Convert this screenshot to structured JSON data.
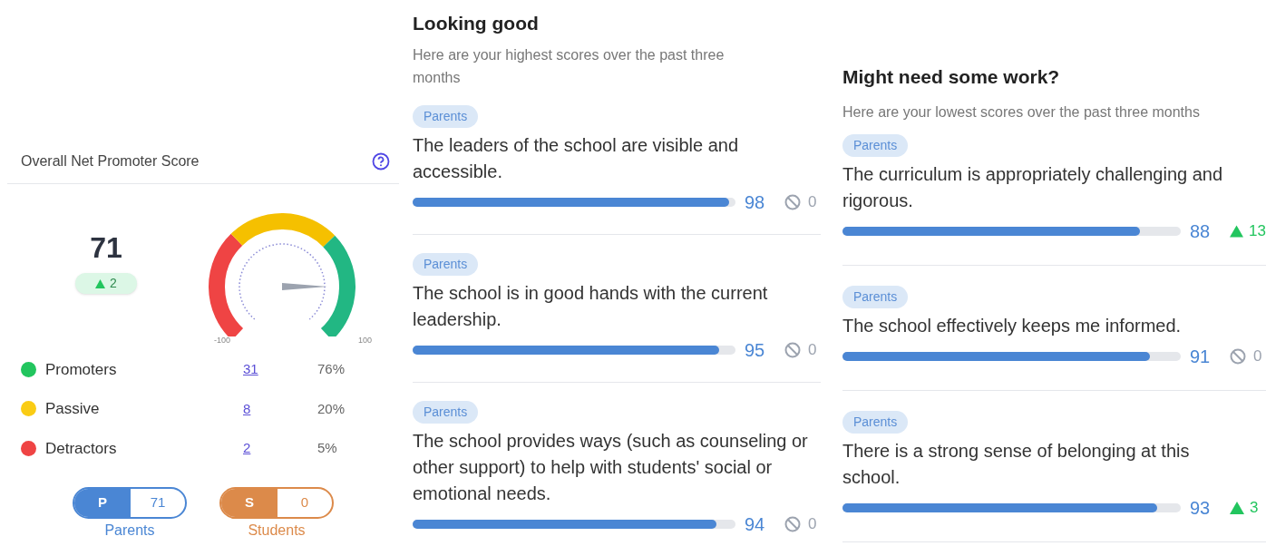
{
  "nps": {
    "title": "Overall Net Promoter Score",
    "score": "71",
    "change": "2",
    "gauge_min": "-100",
    "gauge_max": "100",
    "legend": [
      {
        "label": "Promoters",
        "count": "31",
        "percent": "76%",
        "color": "#22c55e"
      },
      {
        "label": "Passive",
        "count": "8",
        "percent": "20%",
        "color": "#facc15"
      },
      {
        "label": "Detractors",
        "count": "2",
        "percent": "5%",
        "color": "#ef4444"
      }
    ],
    "segments": [
      {
        "letter": "P",
        "score": "71",
        "label": "Parents",
        "color": "#4a86d4"
      },
      {
        "letter": "S",
        "score": "0",
        "label": "Students",
        "color": "#dc8a4a"
      }
    ]
  },
  "highest": {
    "title": "Looking good",
    "subtitle": "Here are your highest scores over the past three months",
    "items": [
      {
        "tag": "Parents",
        "text": "The leaders of the school are visible and accessible.",
        "level": 0.98,
        "score": "98",
        "change": {
          "kind": "none",
          "value": "0"
        }
      },
      {
        "tag": "Parents",
        "text": "The school is in good hands with the current leadership.",
        "level": 0.95,
        "score": "95",
        "change": {
          "kind": "none",
          "value": "0"
        }
      },
      {
        "tag": "Parents",
        "text": "The school provides ways (such as counseling or other support) to help with students' social or emotional needs.",
        "level": 0.94,
        "score": "94",
        "change": {
          "kind": "none",
          "value": "0"
        }
      }
    ]
  },
  "lowest": {
    "title": "Might need some work?",
    "subtitle": "Here are your lowest scores over the past three months",
    "items": [
      {
        "tag": "Parents",
        "text": "The curriculum is appropriately challenging and rigorous.",
        "level": 0.88,
        "score": "88",
        "change": {
          "kind": "up",
          "value": "13"
        }
      },
      {
        "tag": "Parents",
        "text": "The school effectively keeps me informed.",
        "level": 0.91,
        "score": "91",
        "change": {
          "kind": "none",
          "value": "0"
        }
      },
      {
        "tag": "Parents",
        "text": "There is a strong sense of belonging at this school.",
        "level": 0.93,
        "score": "93",
        "change": {
          "kind": "up",
          "value": "3"
        }
      }
    ]
  }
}
